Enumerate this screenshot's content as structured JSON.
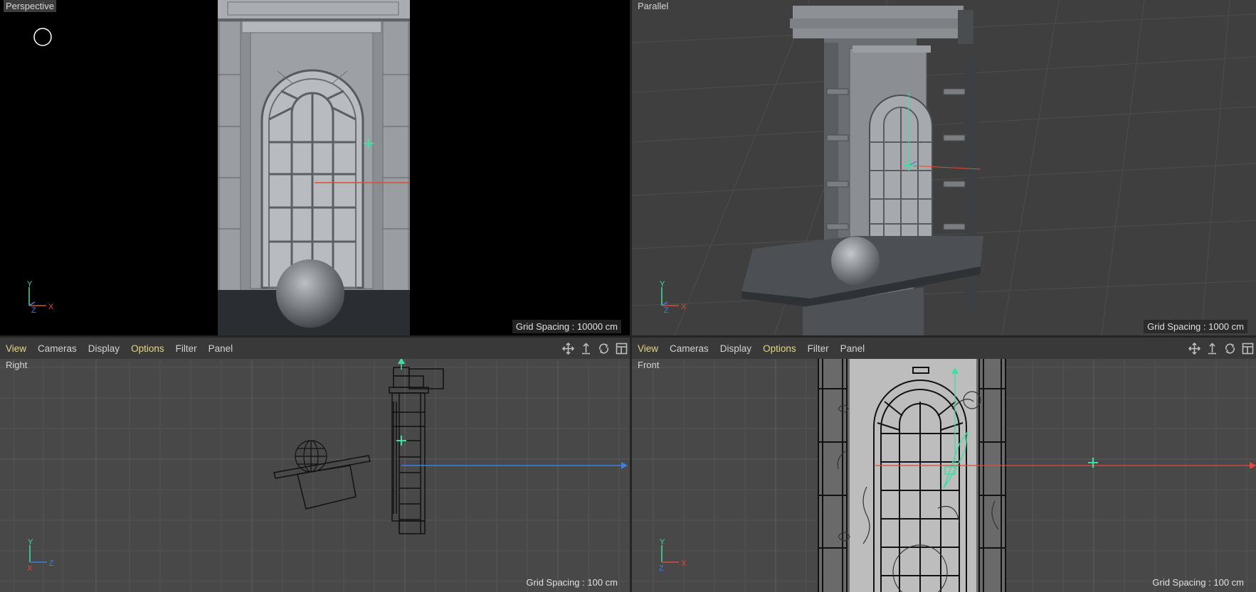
{
  "viewports": {
    "perspective": {
      "label": "Perspective",
      "grid_spacing": "Grid Spacing : 10000 cm",
      "axes": [
        "Y",
        "Z",
        "X"
      ]
    },
    "parallel": {
      "label": "Parallel",
      "grid_spacing": "Grid Spacing : 1000 cm",
      "axes": [
        "Y",
        "Z",
        "X"
      ]
    },
    "right": {
      "label": "Right",
      "grid_spacing": "Grid Spacing : 100 cm",
      "axes": [
        "Y",
        "X",
        "Z"
      ]
    },
    "front": {
      "label": "Front",
      "grid_spacing": "Grid Spacing : 100 cm",
      "axes": [
        "Y",
        "Z",
        "X"
      ]
    }
  },
  "menus": {
    "right": {
      "view": "View",
      "cameras": "Cameras",
      "display": "Display",
      "options": "Options",
      "filter": "Filter",
      "panel": "Panel"
    },
    "front": {
      "view": "View",
      "cameras": "Cameras",
      "display": "Display",
      "options": "Options",
      "filter": "Filter",
      "panel": "Panel"
    }
  },
  "toolbar_icons": [
    "move-view-icon",
    "zoom-view-icon",
    "rotate-view-icon",
    "toggle-layout-icon"
  ],
  "colors": {
    "menu_highlight": "#e5d68a",
    "axis_x": "#e04a3a",
    "axis_y": "#3ce0a0",
    "axis_z": "#3b7fe0",
    "viewport_bg": "#484848"
  }
}
